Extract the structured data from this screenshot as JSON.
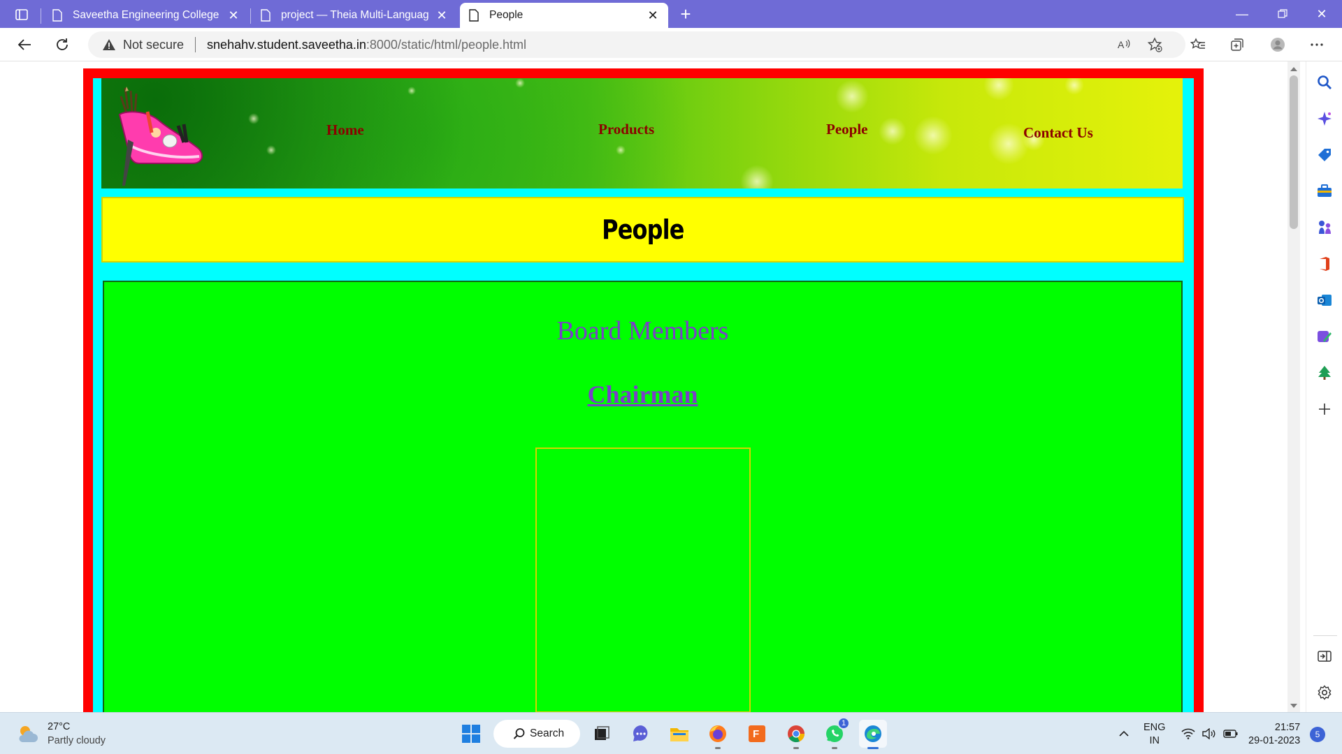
{
  "browser": {
    "tabs": [
      {
        "title": "Saveetha Engineering College",
        "active": false
      },
      {
        "title": "project — Theia Multi-Language",
        "active": false
      },
      {
        "title": "People",
        "active": true
      }
    ],
    "address": {
      "security_label": "Not secure",
      "url_host": "snehahv.student.saveetha.in",
      "url_rest": ":8000/static/html/people.html"
    },
    "theme_color": "#6f6bd6"
  },
  "page": {
    "nav": {
      "home": "Home",
      "products": "Products",
      "people": "People",
      "contact": "Contact Us"
    },
    "heading": "People",
    "board_title": "Board Members",
    "chairman_label": "Chairman",
    "colors": {
      "outer_border": "#ff0000",
      "inner_border": "#00ffff",
      "heading_bg": "#ffff00",
      "panel_bg": "#00ff00",
      "link_color": "#8b0000",
      "board_text": "#7a3fc8"
    }
  },
  "taskbar": {
    "weather_temp": "27°C",
    "weather_desc": "Partly cloudy",
    "search_label": "Search",
    "whatsapp_badge": "1",
    "lang_line1": "ENG",
    "lang_line2": "IN",
    "time": "21:57",
    "date": "29-01-2023",
    "notification_count": "5"
  }
}
